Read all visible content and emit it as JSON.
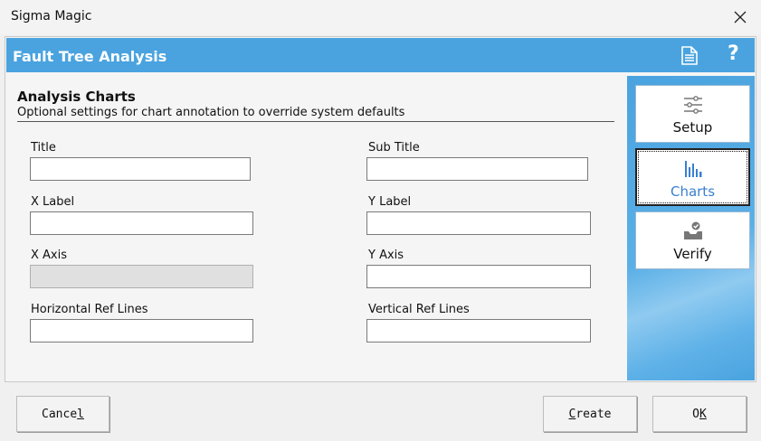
{
  "window": {
    "title": "Sigma Magic"
  },
  "header": {
    "title": "Fault Tree Analysis"
  },
  "section": {
    "title": "Analysis Charts",
    "subtitle": "Optional settings for chart annotation to override system defaults"
  },
  "fields": {
    "title": {
      "label": "Title",
      "value": ""
    },
    "subtitle": {
      "label": "Sub Title",
      "value": ""
    },
    "xlabel": {
      "label": "X Label",
      "value": ""
    },
    "ylabel": {
      "label": "Y Label",
      "value": ""
    },
    "xaxis": {
      "label": "X Axis",
      "value": "",
      "disabled": true
    },
    "yaxis": {
      "label": "Y Axis",
      "value": ""
    },
    "href": {
      "label": "Horizontal Ref Lines",
      "value": ""
    },
    "vref": {
      "label": "Vertical Ref Lines",
      "value": ""
    }
  },
  "nav": [
    {
      "label": "Setup",
      "icon": "sliders-icon",
      "active": false
    },
    {
      "label": "Charts",
      "icon": "bar-chart-icon",
      "active": true
    },
    {
      "label": "Verify",
      "icon": "verify-icon",
      "active": false
    }
  ],
  "buttons": {
    "cancel": {
      "pre": "Cance",
      "key": "l",
      "post": ""
    },
    "create": {
      "pre": "",
      "key": "C",
      "post": "reate"
    },
    "ok": {
      "pre": "O",
      "key": "K",
      "post": ""
    }
  },
  "colors": {
    "accent": "#4aa3df",
    "active_nav_text": "#3a7fd0"
  }
}
